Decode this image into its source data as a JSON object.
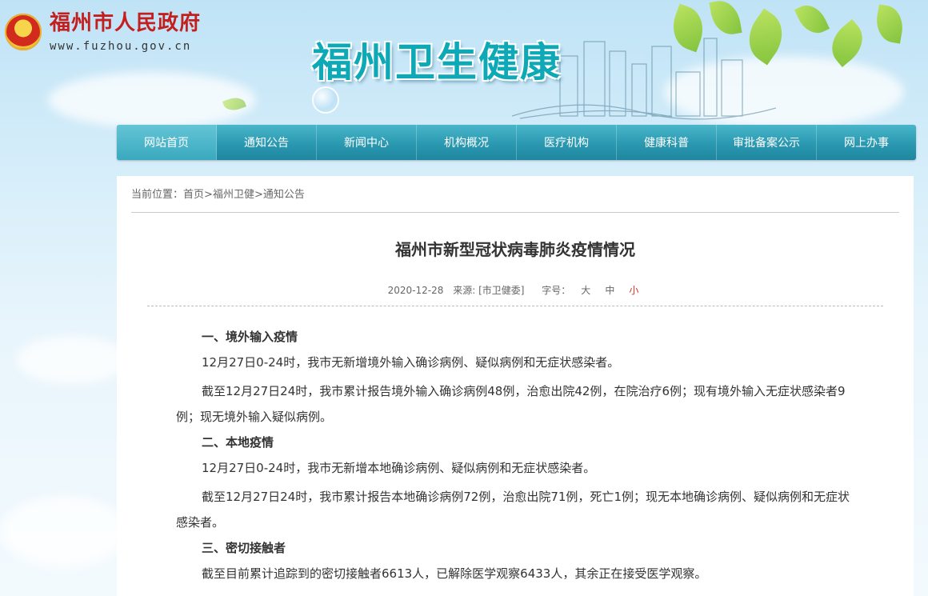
{
  "header": {
    "gov_name": "福州市人民政府",
    "gov_url": "www.fuzhou.gov.cn",
    "site_title": "福州卫生健康"
  },
  "nav": {
    "items": [
      "网站首页",
      "通知公告",
      "新闻中心",
      "机构概况",
      "医疗机构",
      "健康科普",
      "审批备案公示",
      "网上办事"
    ],
    "active_index": 0
  },
  "breadcrumb": {
    "prefix": "当前位置：",
    "items": [
      "首页",
      "福州卫健",
      "通知公告"
    ],
    "separator": ">"
  },
  "article": {
    "title": "福州市新型冠状病毒肺炎疫情情况",
    "date": "2020-12-28",
    "source": "来源: [市卫健委]",
    "font_size_label": "字号：",
    "font_sizes": [
      "大",
      "中",
      "小"
    ],
    "current_font_size": "小",
    "sections": [
      {
        "heading": "一、境外输入疫情",
        "paragraphs": [
          "12月27日0-24时，我市无新增境外输入确诊病例、疑似病例和无症状感染者。",
          "截至12月27日24时，我市累计报告境外输入确诊病例48例，治愈出院42例，在院治疗6例；现有境外输入无症状感染者9例；现无境外输入疑似病例。"
        ]
      },
      {
        "heading": "二、本地疫情",
        "paragraphs": [
          "12月27日0-24时，我市无新增本地确诊病例、疑似病例和无症状感染者。",
          "截至12月27日24时，我市累计报告本地确诊病例72例，治愈出院71例，死亡1例；现无本地确诊病例、疑似病例和无症状感染者。"
        ]
      },
      {
        "heading": "三、密切接触者",
        "paragraphs": [
          "截至目前累计追踪到的密切接触者6613人，已解除医学观察6433人，其余正在接受医学观察。"
        ]
      }
    ]
  },
  "colors": {
    "gov_red": "#c41f1f",
    "nav_teal": "#2a98b0",
    "title_teal": "#0ea9b6",
    "current_font": "#d9342b"
  },
  "icons": [
    "national-emblem-icon",
    "leaf-decoration",
    "bubble-decoration",
    "skyline-decoration"
  ]
}
